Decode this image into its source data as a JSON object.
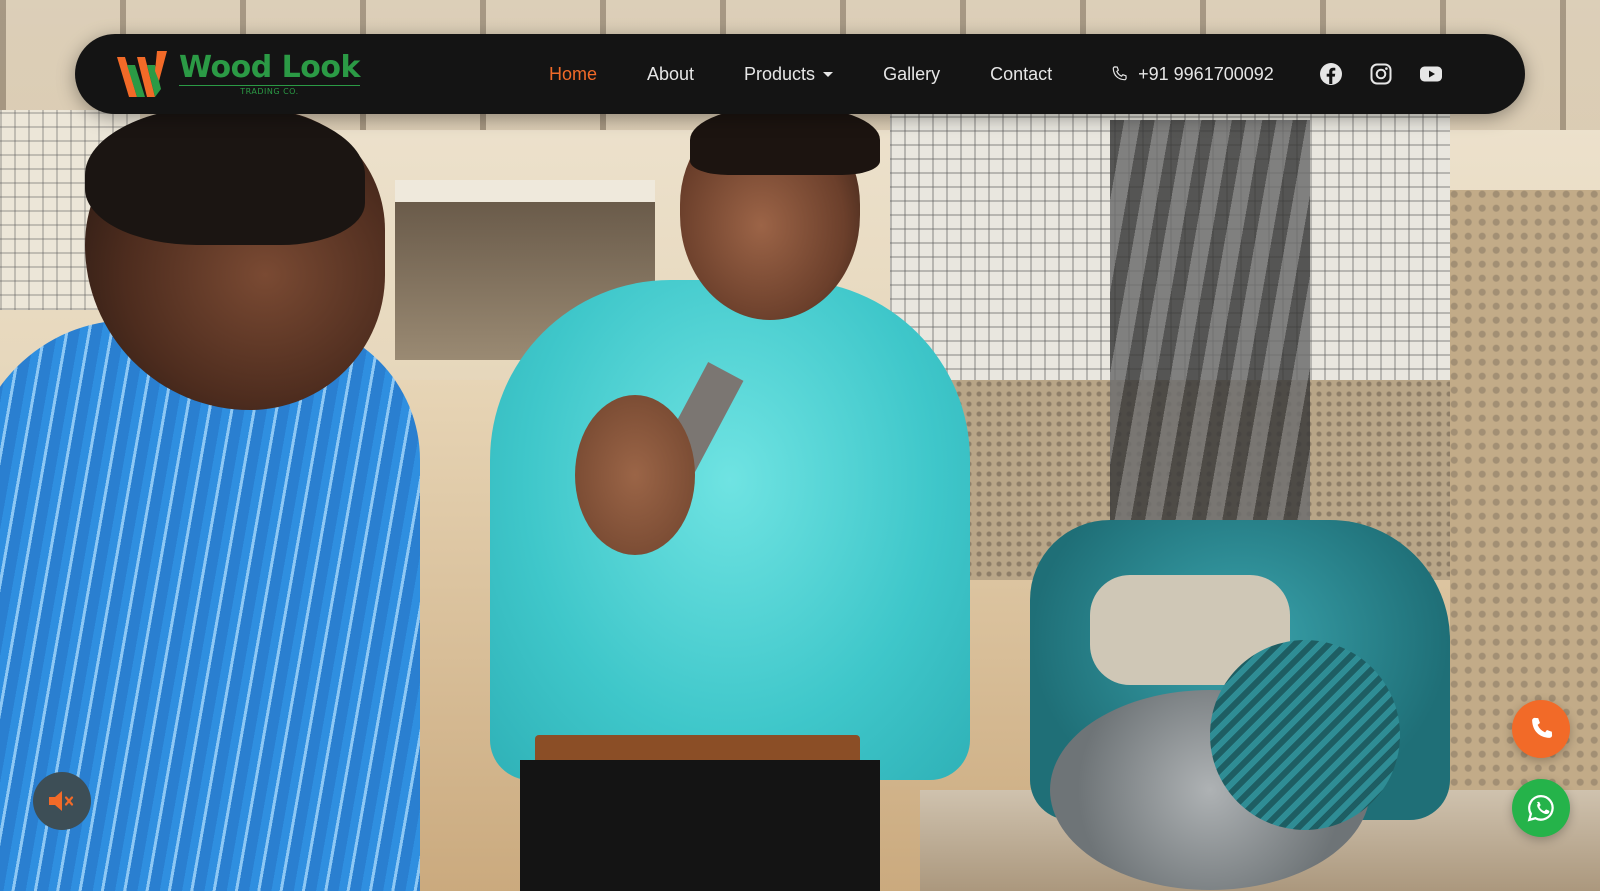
{
  "brand": {
    "name": "Wood Look",
    "subtitle": "TRADING CO.",
    "logo_icon": "wood-planks-logo",
    "color_primary": "#2b9a45",
    "color_accent": "#f26a28"
  },
  "nav": {
    "items": [
      {
        "label": "Home",
        "active": true
      },
      {
        "label": "About",
        "active": false
      },
      {
        "label": "Products",
        "active": false,
        "has_dropdown": true
      },
      {
        "label": "Gallery",
        "active": false
      },
      {
        "label": "Contact",
        "active": false
      }
    ],
    "phone": {
      "icon": "phone-icon",
      "number": "+91 9961700092"
    },
    "social": [
      {
        "name": "Facebook",
        "icon": "facebook-icon"
      },
      {
        "name": "Instagram",
        "icon": "instagram-icon"
      },
      {
        "name": "YouTube",
        "icon": "youtube-icon"
      }
    ],
    "background": "#141414"
  },
  "hero": {
    "media": "background-video",
    "muted": true
  },
  "floating_buttons": {
    "mute": {
      "icon": "speaker-muted-icon",
      "color": "#3d4e56"
    },
    "call": {
      "icon": "phone-icon",
      "color": "#f26a28"
    },
    "whatsapp": {
      "icon": "whatsapp-icon",
      "color": "#25b34a"
    }
  }
}
